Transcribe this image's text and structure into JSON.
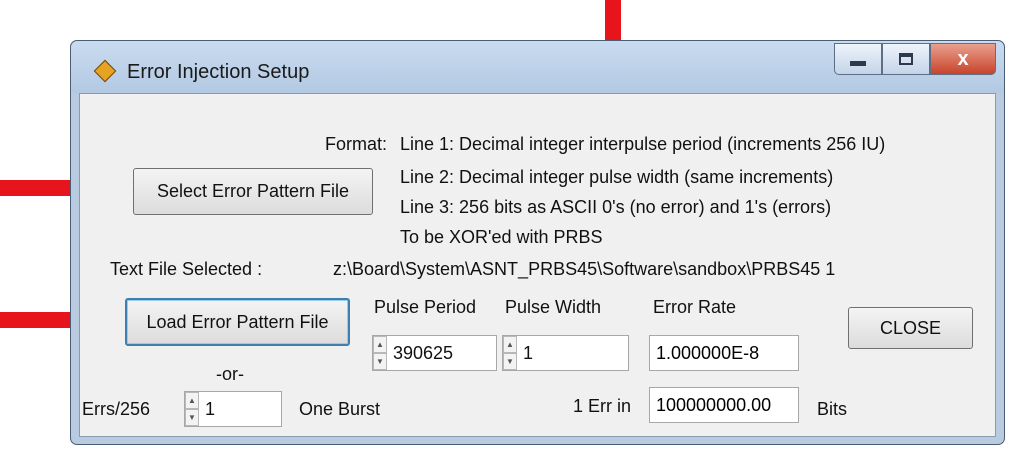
{
  "window": {
    "title": "Error Injection Setup",
    "close_glyph": "x"
  },
  "format": {
    "label": "Format:",
    "line1": "Line 1: Decimal integer interpulse period (increments 256 IU)",
    "line2": "Line 2: Decimal integer pulse width (same increments)",
    "line3": "Line 3: 256 bits as ASCII 0's (no error) and 1's (errors)",
    "line4": "To be XOR'ed with PRBS"
  },
  "select_button_label": "Select Error Pattern File",
  "text_file": {
    "label": "Text File Selected :",
    "path": "z:\\Board\\System\\ASNT_PRBS45\\Software\\sandbox\\PRBS45 1"
  },
  "load_button_label": "Load Error Pattern File",
  "pulse_period": {
    "label": "Pulse Period",
    "value": "390625"
  },
  "pulse_width": {
    "label": "Pulse Width",
    "value": "1"
  },
  "error_rate": {
    "label": "Error Rate",
    "value": "1.000000E-8"
  },
  "close_button_label": "CLOSE",
  "or_label": "-or-",
  "errs": {
    "label": "Errs/256",
    "value": "1"
  },
  "one_burst_label": "One Burst",
  "err_in": {
    "label": "1 Err in",
    "value": "100000000.00",
    "unit": "Bits"
  },
  "colors": {
    "arrow": "#e8141c",
    "titlebar": "#b9cde5",
    "focus": "#3c7fb1"
  }
}
